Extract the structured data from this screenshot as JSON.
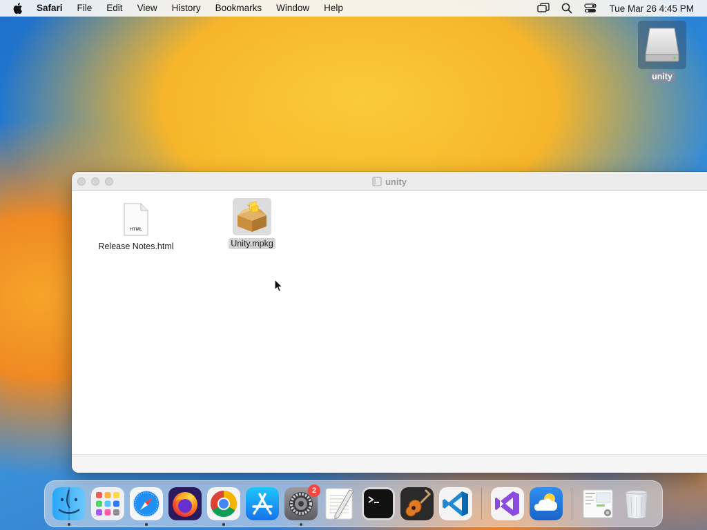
{
  "menubar": {
    "app_name": "Safari",
    "items": [
      {
        "label": "File"
      },
      {
        "label": "Edit"
      },
      {
        "label": "View"
      },
      {
        "label": "History"
      },
      {
        "label": "Bookmarks"
      },
      {
        "label": "Window"
      },
      {
        "label": "Help"
      }
    ],
    "clock": "Tue Mar 26  4:45 PM"
  },
  "desktop": {
    "drive_label": "unity"
  },
  "finder": {
    "title": "unity",
    "files": [
      {
        "name": "Release Notes.html",
        "icon_text": "HTML",
        "selected": false
      },
      {
        "name": "Unity.mpkg",
        "selected": true
      }
    ]
  },
  "dock": {
    "apps": [
      {
        "name": "Finder",
        "running": true
      },
      {
        "name": "Launchpad",
        "running": false
      },
      {
        "name": "Safari",
        "running": true
      },
      {
        "name": "Firefox",
        "running": false
      },
      {
        "name": "Google Chrome",
        "running": true
      },
      {
        "name": "App Store",
        "running": false
      },
      {
        "name": "System Settings",
        "running": true,
        "badge": "2"
      },
      {
        "name": "TextEdit",
        "running": false
      },
      {
        "name": "Terminal",
        "running": false
      },
      {
        "name": "GarageBand",
        "running": false
      },
      {
        "name": "Visual Studio Code",
        "running": false
      }
    ],
    "recent_apps": [
      {
        "name": "Visual Studio",
        "running": false
      },
      {
        "name": "Weather",
        "running": false
      }
    ],
    "trash_label": "Trash"
  },
  "colors": {
    "accent": "#0a84ff",
    "badge": "#f2463e"
  }
}
